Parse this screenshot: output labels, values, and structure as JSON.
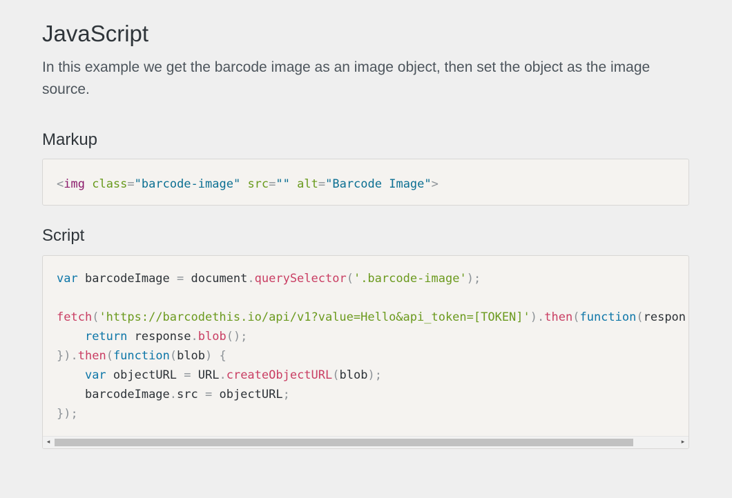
{
  "page": {
    "title": "JavaScript",
    "intro": "In this example we get the barcode image as an image object, then set the object as the image source."
  },
  "markup": {
    "heading": "Markup",
    "code": {
      "lt": "<",
      "tag": "img",
      "sp1": " ",
      "attr1": "class",
      "eq1": "=",
      "val1": "\"barcode-image\"",
      "sp2": " ",
      "attr2": "src",
      "eq2": "=",
      "val2": "\"\"",
      "sp3": " ",
      "attr3": "alt",
      "eq3": "=",
      "val3": "\"Barcode Image\"",
      "gt": ">"
    }
  },
  "script": {
    "heading": "Script",
    "lines": {
      "l1_kw": "var",
      "l1_a": " barcodeImage ",
      "l1_eq": "=",
      "l1_b": " document",
      "l1_dot": ".",
      "l1_fn": "querySelector",
      "l1_p1": "(",
      "l1_str": "'.barcode-image'",
      "l1_p2": ");",
      "l3_fn": "fetch",
      "l3_p1": "(",
      "l3_str": "'https://barcodethis.io/api/v1?value=Hello&api_token=[TOKEN]'",
      "l3_p2": ")",
      "l3_dot": ".",
      "l3_then": "then",
      "l3_p3": "(",
      "l3_kw": "function",
      "l3_p4": "(",
      "l3_arg": "respon",
      "l4_indent": "    ",
      "l4_kw": "return",
      "l4_a": " response",
      "l4_dot": ".",
      "l4_fn": "blob",
      "l4_p": "();",
      "l5_p1": "})",
      "l5_dot": ".",
      "l5_then": "then",
      "l5_p2": "(",
      "l5_kw": "function",
      "l5_p3": "(",
      "l5_arg": "blob",
      "l5_p4": ")",
      "l5_sp": " ",
      "l5_brace": "{",
      "l6_indent": "    ",
      "l6_kw": "var",
      "l6_a": " objectURL ",
      "l6_eq": "=",
      "l6_b": " URL",
      "l6_dot": ".",
      "l6_fn": "createObjectURL",
      "l6_p1": "(",
      "l6_arg": "blob",
      "l6_p2": ");",
      "l7_indent": "    ",
      "l7_a": "barcodeImage",
      "l7_dot": ".",
      "l7_b": "src ",
      "l7_eq": "=",
      "l7_c": " objectURL",
      "l7_p": ";",
      "l8_p": "});"
    }
  },
  "scrollbar": {
    "left_arrow": "◂",
    "right_arrow": "▸"
  },
  "colors": {
    "background": "#efefef",
    "code_background": "#f5f3f0",
    "keyword": "#0d76a8",
    "function": "#c93e63",
    "string": "#6b9a1e",
    "tag": "#8b1a6b",
    "attribute_value": "#0b6f92"
  }
}
